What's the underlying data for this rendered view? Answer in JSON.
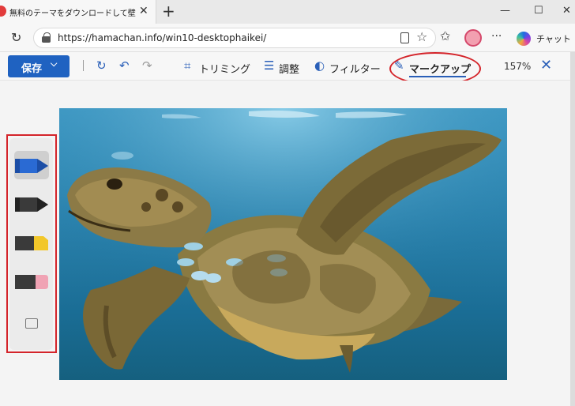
{
  "browser": {
    "tab_title": "無料のテーマをダウンロードして壁紙を変",
    "tab_close": "✕",
    "new_tab": "+",
    "window_buttons": [
      "—",
      "☐",
      "✕"
    ],
    "url": "https://hamachan.info/win10-desktophaikei/",
    "more": "···",
    "chat_label": "チャット"
  },
  "toolbar": {
    "save_label": "保存",
    "save_chevron": "⌵",
    "history_icon": "↻",
    "undo_icon": "↶",
    "redo_icon": "↷",
    "items": [
      {
        "label": "トリミング",
        "icon": "⌗"
      },
      {
        "label": "調整",
        "icon": "☰"
      },
      {
        "label": "フィルター",
        "icon": "◐"
      },
      {
        "label": "マークアップ",
        "icon": "✎"
      }
    ],
    "zoom": "157%",
    "close": "✕"
  },
  "palette": {
    "tools": [
      "blue-pen",
      "black-pen",
      "yellow-highlighter",
      "eraser-pen",
      "eraser"
    ]
  },
  "colors": {
    "accent": "#1f62c1",
    "annotation": "#d4242a",
    "pen_blue": "#2a6ad3",
    "highlighter": "#f2c72a",
    "eraser_pink": "#f0a3b4"
  }
}
